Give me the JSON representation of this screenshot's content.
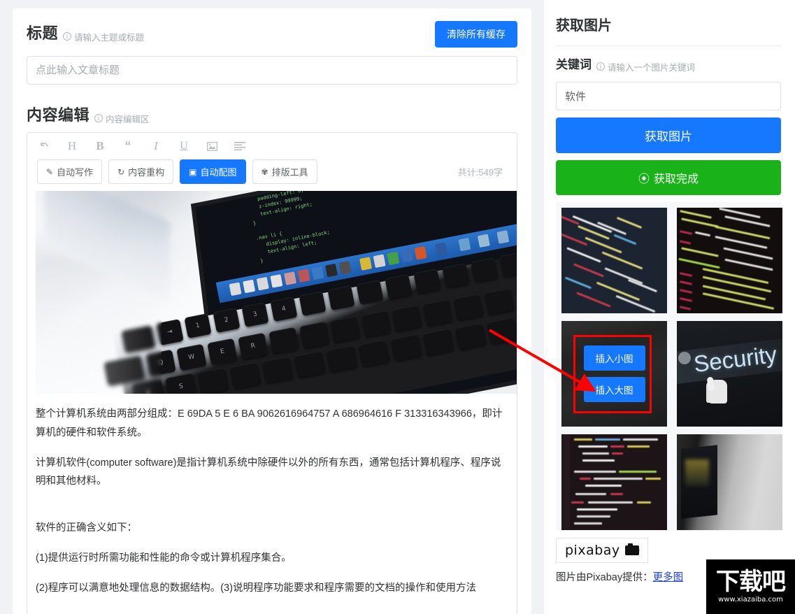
{
  "header": {
    "title_label": "标题",
    "title_hint": "请输入主题或标题",
    "clear_cache_button": "清除所有缓存",
    "title_placeholder": "点此输入文章标题",
    "title_value": ""
  },
  "content_section": {
    "label": "内容编辑",
    "hint": "内容编辑区"
  },
  "editor": {
    "icons": [
      {
        "name": "undo-icon",
        "glyph": "↶"
      },
      {
        "name": "heading-icon",
        "glyph": "H"
      },
      {
        "name": "bold-icon",
        "glyph": "B"
      },
      {
        "name": "quote-icon",
        "glyph": "❝"
      },
      {
        "name": "italic-icon",
        "glyph": "I"
      },
      {
        "name": "underline-icon",
        "glyph": "U"
      },
      {
        "name": "image-icon",
        "glyph": "🖼"
      },
      {
        "name": "align-icon",
        "glyph": "≡"
      }
    ],
    "buttons": [
      {
        "label": "自动写作",
        "icon": "✎",
        "active": false
      },
      {
        "label": "内容重构",
        "icon": "↻",
        "active": false
      },
      {
        "label": "自动配图",
        "icon": "▣",
        "active": true
      },
      {
        "label": "排版工具",
        "icon": "✾",
        "active": false
      }
    ],
    "word_count": "共计:549字",
    "paragraphs": [
      "整个计算机系统由两部分组成：E 69DA 5 E 6 BA 9062616964757 A 686964616 F 313316343966，即计算机的硬件和软件系统。",
      "计算机软件(computer software)是指计算机系统中除硬件以外的所有东西，通常包括计算机程序、程序说明和其他材料。",
      "软件的正确含义如下：",
      "(1)提供运行时所需功能和性能的命令或计算机程序集合。",
      "(2)程序可以满意地处理信息的数据结构。(3)说明程序功能要求和程序需要的文档的操作和使用方法"
    ],
    "photo_code_lines": [
      "      padding-left: 0;",
      "      z-index: 99999;",
      "      text-align: right;",
      "   }",
      "",
      "   .nav li {",
      "      display: inline-block;",
      "      text-align: left;",
      "   }"
    ]
  },
  "image_panel": {
    "title": "获取图片",
    "keyword_label": "关键词",
    "keyword_hint": "请输入一个图片关键词",
    "keyword_value": "软件",
    "keyword_placeholder": "请输入一个图片关键词",
    "fetch_button": "获取图片",
    "done_button": "获取完成",
    "done_icon": "⊘",
    "insert_small_button": "插入小图",
    "insert_large_button": "插入大图",
    "thumbnails": [
      {
        "name": "thumbnail-code-dark-blue",
        "kind": "code1"
      },
      {
        "name": "thumbnail-code-dark-red",
        "kind": "code2"
      },
      {
        "name": "thumbnail-laptop-keyboard-hovered",
        "kind": "hovered"
      },
      {
        "name": "thumbnail-security-sign",
        "kind": "security"
      },
      {
        "name": "thumbnail-code-editor",
        "kind": "code3"
      },
      {
        "name": "thumbnail-bright-laptop",
        "kind": "bright"
      }
    ],
    "security_text": "Security",
    "provider_logo": "pixabay",
    "credit_prefix": "图片由Pixabay提供：",
    "credit_link": "更多图"
  },
  "watermark": {
    "main": "下载吧",
    "sub": "www.xiazaiba.com"
  },
  "colors": {
    "primary_blue": "#1677ff",
    "success_green": "#19b319",
    "annotation_red": "#ff0000",
    "link_blue": "#1a3fd6",
    "page_bg": "#f0f2f5"
  }
}
